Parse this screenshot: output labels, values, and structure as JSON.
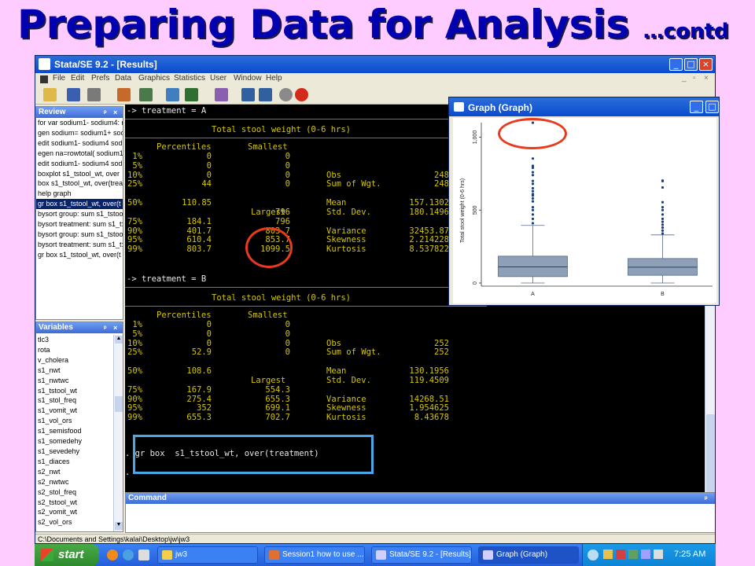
{
  "slide": {
    "title": "Preparing Data for Analysis",
    "title_suffix": "…contd"
  },
  "stata": {
    "window_title": "Stata/SE 9.2 - [Results]",
    "menu": [
      "File",
      "Edit",
      "Prefs",
      "Data",
      "Graphics",
      "Statistics",
      "User",
      "Window",
      "Help"
    ],
    "review": {
      "title": "Review",
      "items": [
        "for var  sodium1- sodium4: r",
        "gen sodium= sodium1+ sod",
        "edit  sodium1- sodium4 sod",
        "egen na=rowtotal( sodium1",
        "edit  sodium1- sodium4 sod",
        "boxplot  s1_tstool_wt, over",
        "box  s1_tstool_wt, over(trea",
        "help graph",
        "gr box  s1_tstool_wt, over(t",
        "bysort group: sum  s1_tstoo",
        "bysort treatment: sum  s1_t:",
        "bysort group: sum  s1_tstoo",
        "bysort treatment: sum  s1_t:",
        "gr box  s1_tstool_wt, over(t"
      ],
      "selected_index": 8
    },
    "variables": {
      "title": "Variables",
      "items": [
        "tlc3",
        "rota",
        "v_cholera",
        "s1_nwt",
        "s1_nwtwc",
        "s1_tstool_wt",
        "s1_stol_freq",
        "s1_vomit_wt",
        "s1_vol_ors",
        "s1_semisfood",
        "s1_somedehy",
        "s1_sevedehy",
        "s1_diaces",
        "s2_nwt",
        "s2_nwtwc",
        "s2_stol_freq",
        "s2_tstool_wt",
        "s2_vomit_wt",
        "s2_vol_ors"
      ]
    },
    "results": {
      "groupA": {
        "header": "-> treatment = A",
        "subtitle": "Total stool weight (0-6 hrs)",
        "col_percentiles": "Percentiles",
        "col_smallest": "Smallest",
        "col_largest": "Largest",
        "rows": [
          {
            "p": "1%",
            "v": "0",
            "s": "0",
            "lbl": "",
            "val": ""
          },
          {
            "p": "5%",
            "v": "0",
            "s": "0",
            "lbl": "",
            "val": ""
          },
          {
            "p": "10%",
            "v": "0",
            "s": "0",
            "lbl": "Obs",
            "val": "248"
          },
          {
            "p": "25%",
            "v": "44",
            "s": "0",
            "lbl": "Sum of Wgt.",
            "val": "248"
          },
          {
            "p": "50%",
            "v": "110.85",
            "s": "",
            "lbl": "Mean",
            "val": "157.1302"
          },
          {
            "p": "",
            "v": "",
            "s": "796",
            "lbl": "Std. Dev.",
            "val": "180.1496"
          },
          {
            "p": "75%",
            "v": "184.1",
            "s": "796",
            "lbl": "",
            "val": ""
          },
          {
            "p": "90%",
            "v": "401.7",
            "s": "803.7",
            "lbl": "Variance",
            "val": "32453.87"
          },
          {
            "p": "95%",
            "v": "610.4",
            "s": "853.7",
            "lbl": "Skewness",
            "val": "2.214228"
          },
          {
            "p": "99%",
            "v": "803.7",
            "s": "1099.5",
            "lbl": "Kurtosis",
            "val": "8.537822"
          }
        ]
      },
      "groupB": {
        "header": "-> treatment = B",
        "subtitle": "Total stool weight (0-6 hrs)",
        "col_percentiles": "Percentiles",
        "col_smallest": "Smallest",
        "col_largest": "Largest",
        "rows": [
          {
            "p": "1%",
            "v": "0",
            "s": "0",
            "lbl": "",
            "val": ""
          },
          {
            "p": "5%",
            "v": "0",
            "s": "0",
            "lbl": "",
            "val": ""
          },
          {
            "p": "10%",
            "v": "0",
            "s": "0",
            "lbl": "Obs",
            "val": "252"
          },
          {
            "p": "25%",
            "v": "52.9",
            "s": "0",
            "lbl": "Sum of Wgt.",
            "val": "252"
          },
          {
            "p": "50%",
            "v": "108.6",
            "s": "",
            "lbl": "Mean",
            "val": "130.1956"
          },
          {
            "p": "",
            "v": "",
            "s": "",
            "lbl": "Std. Dev.",
            "val": "119.4509"
          },
          {
            "p": "75%",
            "v": "167.9",
            "s": "554.3",
            "lbl": "",
            "val": ""
          },
          {
            "p": "90%",
            "v": "275.4",
            "s": "655.3",
            "lbl": "Variance",
            "val": "14268.51"
          },
          {
            "p": "95%",
            "v": "352",
            "s": "699.1",
            "lbl": "Skewness",
            "val": "1.954625"
          },
          {
            "p": "99%",
            "v": "655.3",
            "s": "702.7",
            "lbl": "Kurtosis",
            "val": "8.43678"
          }
        ]
      },
      "command_echo": ". gr box  s1_tstool_wt, over(treatment)",
      "prompt": "."
    },
    "command_title": "Command",
    "status_path": "C:\\Documents and Settings\\kalai\\Desktop\\jw\\jw3"
  },
  "graph_window": {
    "title": "Graph (Graph)"
  },
  "chart_data": {
    "type": "box",
    "ylabel": "Total stool weight (0-6 hrs)",
    "categories": [
      "A",
      "B"
    ],
    "yticks": [
      0,
      500,
      "1,000"
    ],
    "ylim": [
      0,
      1100
    ],
    "boxes": [
      {
        "name": "A",
        "min": 0,
        "q1": 44,
        "median": 110.85,
        "q3": 184.1,
        "whisker_high": 395,
        "outliers": [
          410,
          440,
          470,
          500,
          520,
          560,
          580,
          600,
          610,
          630,
          650,
          680,
          700,
          740,
          760,
          790,
          803.7,
          853.7,
          1099.5
        ]
      },
      {
        "name": "B",
        "min": 0,
        "q1": 52.9,
        "median": 108.6,
        "q3": 167.9,
        "whisker_high": 330,
        "outliers": [
          340,
          360,
          380,
          400,
          420,
          440,
          470,
          500,
          520,
          554.3,
          655.3,
          699.1,
          702.7
        ]
      }
    ],
    "colors": {
      "box": "#8da0b8",
      "outlier": "#1a3f7a"
    }
  },
  "taskbar": {
    "start": "start",
    "items": [
      "jw3",
      "Session1 how to use ...",
      "Stata/SE 9.2 - [Results]",
      "Graph (Graph)"
    ],
    "active_index": 3,
    "clock": "7:25 AM"
  },
  "colors": {
    "title_blue": "#0000b0",
    "highlight_red": "#e83a1e",
    "highlight_blue": "#4aa8e8",
    "results_yellow": "#d4c600",
    "results_green": "#2ddc2d"
  }
}
